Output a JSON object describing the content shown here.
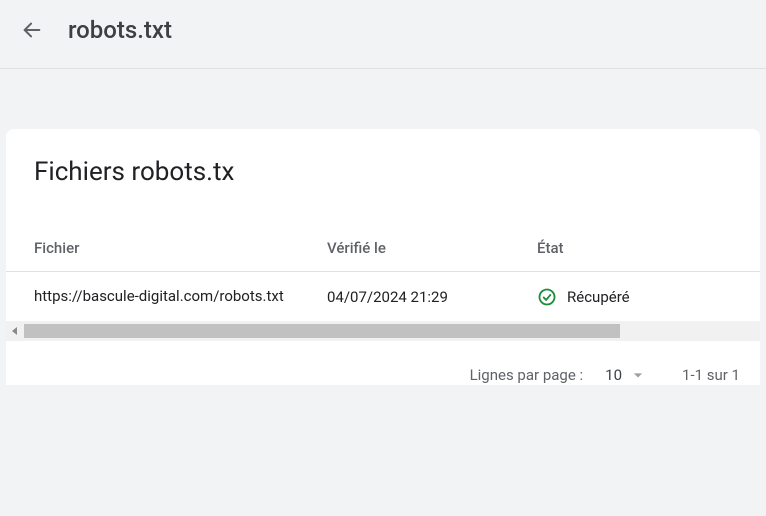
{
  "header": {
    "title": "robots.txt"
  },
  "card": {
    "title": "Fichiers robots.tx"
  },
  "table": {
    "columns": {
      "file": "Fichier",
      "verified": "Vérifié le",
      "status": "État"
    },
    "rows": [
      {
        "file": "https://bascule-digital.com/robots.txt",
        "verified": "04/07/2024 21:29",
        "status": "Récupéré"
      }
    ]
  },
  "pagination": {
    "label": "Lignes par page :",
    "pageSize": "10",
    "range": "1-1 sur 1"
  }
}
